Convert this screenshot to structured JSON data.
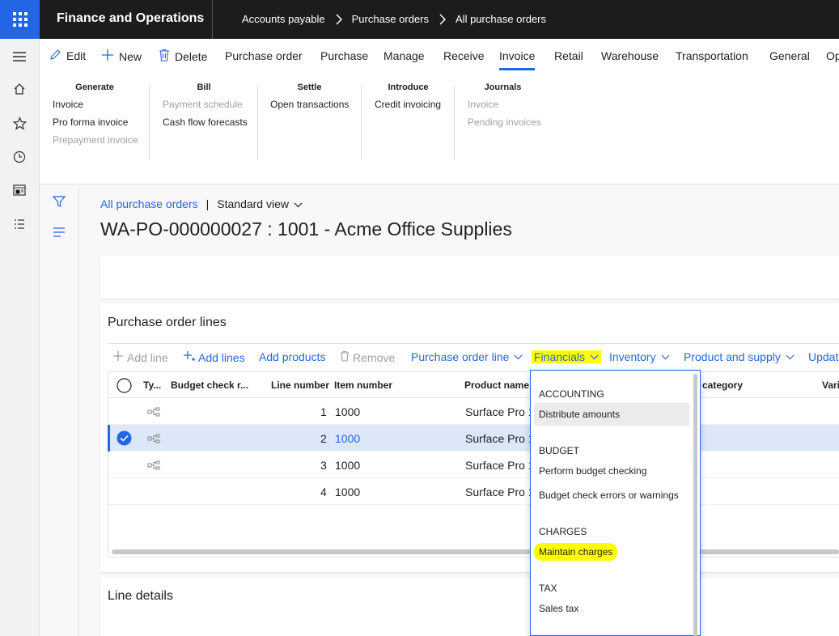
{
  "app": {
    "title": "Finance and Operations",
    "breadcrumb": [
      "Accounts payable",
      "Purchase orders",
      "All purchase orders"
    ]
  },
  "nav": [
    "menu-icon",
    "home-icon",
    "star-icon",
    "clock-icon",
    "workspace-icon",
    "list-icon"
  ],
  "action_pane": {
    "edit": "Edit",
    "new": "New",
    "delete": "Delete",
    "tabs": [
      "Purchase order",
      "Purchase",
      "Manage",
      "Receive",
      "Invoice",
      "Retail",
      "Warehouse",
      "Transportation",
      "General",
      "Op"
    ],
    "active_tab": "Invoice",
    "groups": [
      {
        "title": "Generate",
        "items": [
          {
            "label": "Invoice",
            "enabled": true
          },
          {
            "label": "Pro forma invoice",
            "enabled": true
          },
          {
            "label": "Prepayment invoice",
            "enabled": false
          }
        ]
      },
      {
        "title": "Bill",
        "items": [
          {
            "label": "Payment schedule",
            "enabled": false
          },
          {
            "label": "Cash flow forecasts",
            "enabled": true
          }
        ]
      },
      {
        "title": "Settle",
        "items": [
          {
            "label": "Open transactions",
            "enabled": true
          }
        ]
      },
      {
        "title": "Introduce",
        "items": [
          {
            "label": "Credit invoicing",
            "enabled": true
          }
        ]
      },
      {
        "title": "Journals",
        "items": [
          {
            "label": "Invoice",
            "enabled": false
          },
          {
            "label": "Pending invoices",
            "enabled": false
          }
        ]
      }
    ]
  },
  "page": {
    "back_link": "All purchase orders",
    "view": "Standard view",
    "title": "WA-PO-000000027 : 1001 - Acme Office Supplies"
  },
  "lines": {
    "title": "Purchase order lines",
    "toolbar": {
      "add_line": "Add line",
      "add_lines": "Add lines",
      "add_products": "Add products",
      "remove": "Remove",
      "purchase_order_line": "Purchase order line",
      "financials": "Financials",
      "inventory": "Inventory",
      "product_and_supply": "Product and supply",
      "update": "Updat"
    },
    "columns": {
      "type": "Ty...",
      "budget": "Budget check r...",
      "line_number": "Line number",
      "item_number": "Item number",
      "product_name": "Product name",
      "category": "category",
      "vari": "Vari"
    },
    "rows": [
      {
        "line": "1",
        "item": "1000",
        "product": "Surface Pro 1",
        "selected": false
      },
      {
        "line": "2",
        "item": "1000",
        "product": "Surface Pro 1",
        "selected": true
      },
      {
        "line": "3",
        "item": "1000",
        "product": "Surface Pro 1",
        "selected": false
      },
      {
        "line": "4",
        "item": "1000",
        "product": "Surface Pro 1",
        "selected": false
      }
    ]
  },
  "details": {
    "title": "Line details"
  },
  "financials_menu": {
    "sections": [
      {
        "header": "ACCOUNTING",
        "items": [
          "Distribute amounts"
        ]
      },
      {
        "header": "BUDGET",
        "items": [
          "Perform budget checking",
          "Budget check errors or warnings"
        ]
      },
      {
        "header": "CHARGES",
        "items": [
          "Maintain charges"
        ]
      },
      {
        "header": "TAX",
        "items": [
          "Sales tax"
        ]
      }
    ],
    "highlighted_item": "Maintain charges",
    "hovered_item": "Distribute amounts"
  },
  "colors": {
    "accent": "#2266e3",
    "highlight": "#ffff00",
    "topbar": "#1c1c1c",
    "selected_row": "#dce7fa"
  }
}
